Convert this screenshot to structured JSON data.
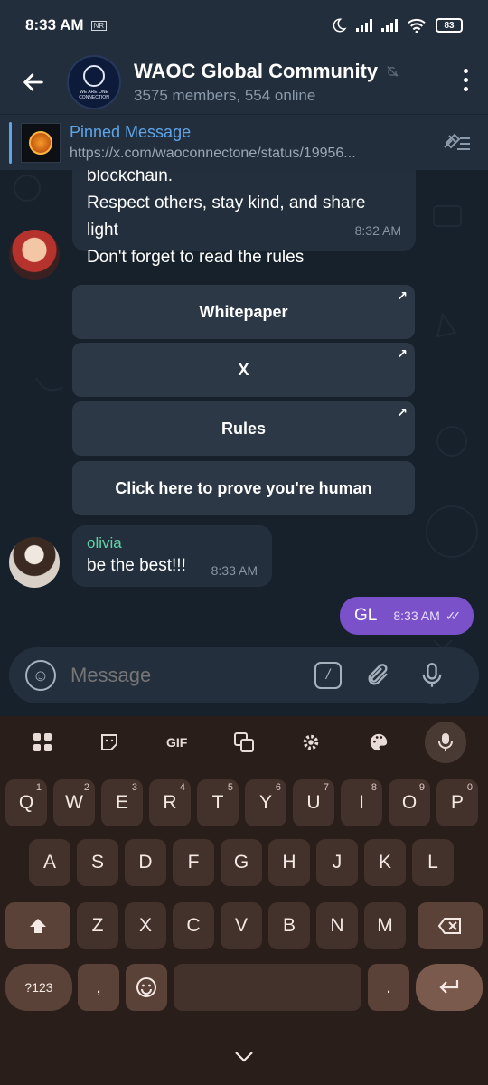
{
  "status_bar": {
    "time": "8:33 AM",
    "sim_label": "NR",
    "battery": "83"
  },
  "header": {
    "title": "WAOC Global Community",
    "subtitle": "3575 members, 554 online",
    "avatar_text": "WE ARE ONE CONNECTION"
  },
  "pinned": {
    "title": "Pinned Message",
    "link": "https://x.com/waoconnectone/status/19956..."
  },
  "messages": {
    "main_lines": [
      "blockchain.",
      "Respect others, stay kind, and share",
      "light",
      "Don't forget to read the rules"
    ],
    "main_time": "8:32 AM",
    "buttons": [
      {
        "label": "Whitepaper",
        "arrow": "↗"
      },
      {
        "label": "X",
        "arrow": "↗"
      },
      {
        "label": "Rules",
        "arrow": "↗"
      },
      {
        "label": "Click here to prove you're human"
      }
    ],
    "olivia": {
      "name": "olivia",
      "text": "be the best!!!",
      "time": "8:33 AM"
    },
    "outgoing": {
      "text": "GL",
      "time": "8:33 AM",
      "checks": "✓✓"
    }
  },
  "input": {
    "placeholder": "Message",
    "command_glyph": "/"
  },
  "keyboard": {
    "toolbar": [
      "apps",
      "sticker",
      "GIF",
      "translate",
      "settings",
      "palette",
      "mic"
    ],
    "gif_label": "GIF",
    "row1": [
      {
        "k": "Q",
        "n": "1"
      },
      {
        "k": "W",
        "n": "2"
      },
      {
        "k": "E",
        "n": "3"
      },
      {
        "k": "R",
        "n": "4"
      },
      {
        "k": "T",
        "n": "5"
      },
      {
        "k": "Y",
        "n": "6"
      },
      {
        "k": "U",
        "n": "7"
      },
      {
        "k": "I",
        "n": "8"
      },
      {
        "k": "O",
        "n": "9"
      },
      {
        "k": "P",
        "n": "0"
      }
    ],
    "row2": [
      "A",
      "S",
      "D",
      "F",
      "G",
      "H",
      "J",
      "K",
      "L"
    ],
    "row3": [
      "Z",
      "X",
      "C",
      "V",
      "B",
      "N",
      "M"
    ],
    "sym_label": "?123",
    "comma": ",",
    "period": "."
  }
}
